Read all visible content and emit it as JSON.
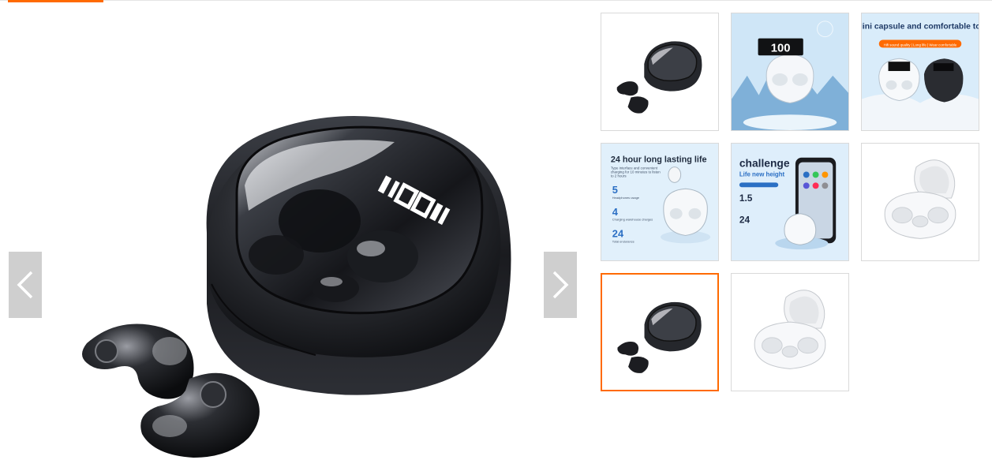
{
  "colors": {
    "accent": "#ff6a00",
    "nav_bg": "#cfcfcf",
    "thumb_border": "#d9d9d9"
  },
  "main_image": {
    "alt_icon": "earbuds-black-case-image"
  },
  "nav": {
    "prev_icon": "chevron-left-icon",
    "next_icon": "chevron-right-icon"
  },
  "thumbnails": [
    {
      "id": "black-case-earbuds"
    },
    {
      "id": "white-case-winter-display",
      "display_text": "100"
    },
    {
      "id": "mini-capsule",
      "title": "The Mini capsule and comfortable to wear",
      "tagline": "Hifi sound quality | Long life | Wear comfortable"
    },
    {
      "id": "lasting-life",
      "title": "24 hour long lasting life",
      "desc": "Type interface and convenient charging for 10 minutes to listen to 2 hours",
      "stat1": "5",
      "stat1_label": "Headphones usage",
      "stat2": "4",
      "stat2_label": "Charging warehouse charges",
      "stat3": "24",
      "stat3_label": "Total endurance"
    },
    {
      "id": "challenge",
      "title": "challenge",
      "subtitle": "Life new height",
      "stat1": "1.5",
      "stat2": "24"
    },
    {
      "id": "white-open-case"
    },
    {
      "id": "black-case-earbuds-selected",
      "selected": true
    },
    {
      "id": "white-open-case-2"
    }
  ]
}
